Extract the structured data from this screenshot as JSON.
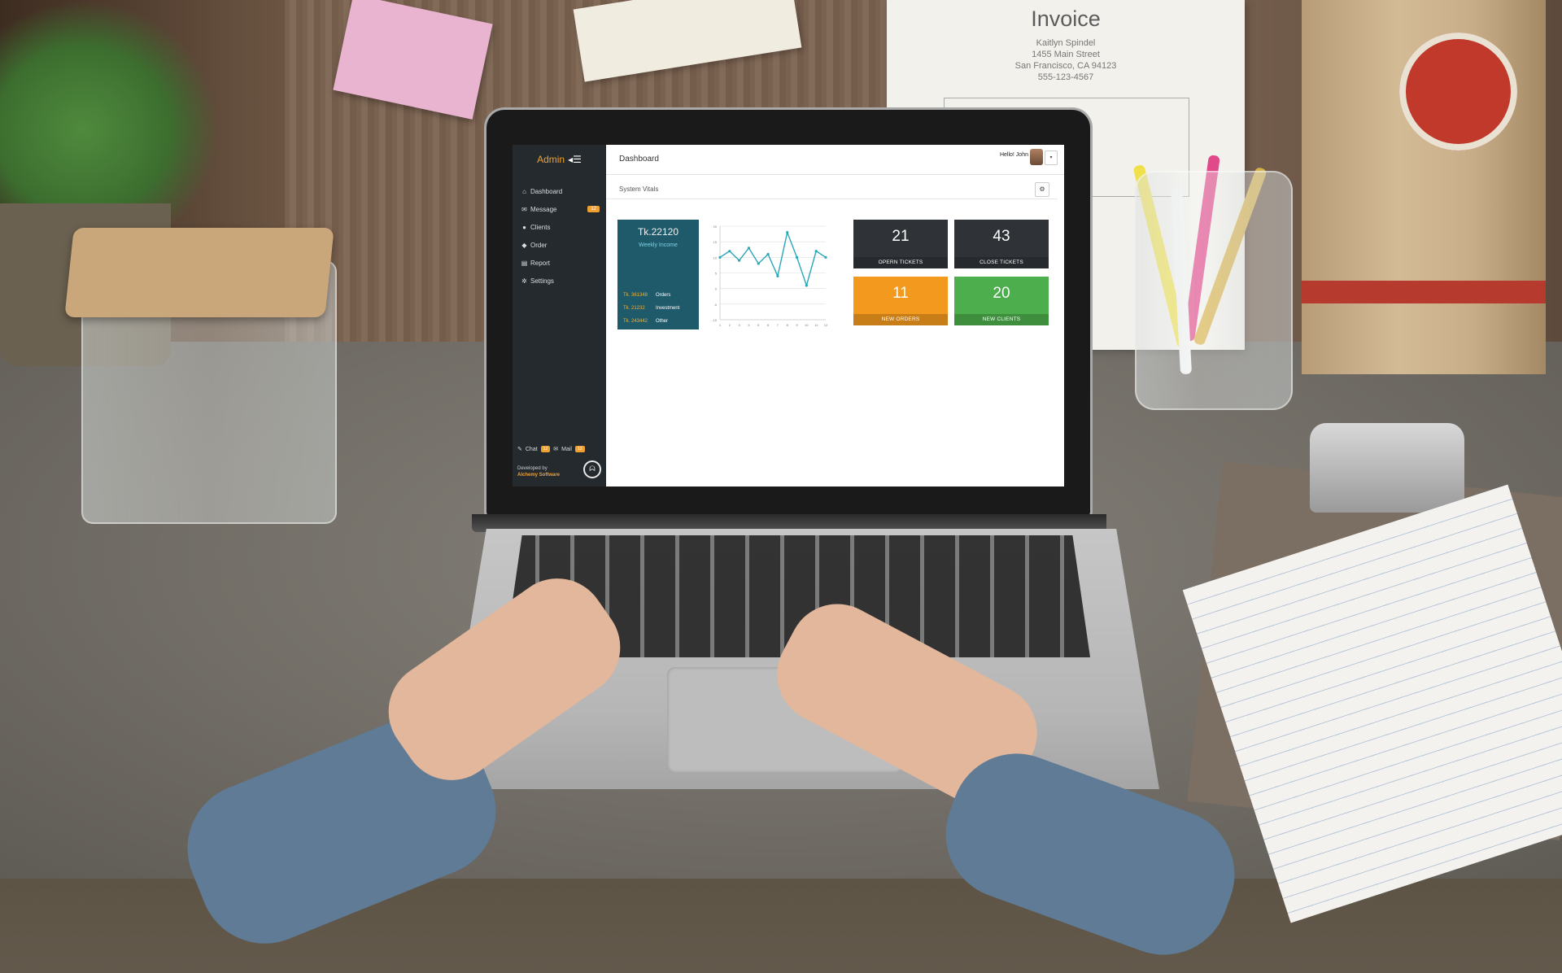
{
  "app": {
    "brand": "Admin",
    "page_title": "Dashboard",
    "greeting": "Hello! John"
  },
  "sidebar": {
    "items": [
      {
        "label": "Dashboard",
        "icon": "home-icon",
        "badge": ""
      },
      {
        "label": "Message",
        "icon": "envelope-icon",
        "badge": "12"
      },
      {
        "label": "Clients",
        "icon": "user-icon",
        "badge": ""
      },
      {
        "label": "Order",
        "icon": "tag-icon",
        "badge": ""
      },
      {
        "label": "Report",
        "icon": "report-icon",
        "badge": ""
      },
      {
        "label": "Settings",
        "icon": "gear-icon",
        "badge": ""
      }
    ],
    "footer": {
      "chat_label": "Chat",
      "chat_badge": "12",
      "mail_label": "Mail",
      "mail_badge": "12"
    },
    "developer": {
      "prefix": "Developed by",
      "company": "Alchemy Software"
    }
  },
  "panel": {
    "title": "System Vitals"
  },
  "income": {
    "amount": "Tk.22120",
    "caption": "Weekly Income",
    "rows": [
      {
        "value": "Tk. 361348",
        "label": "Orders"
      },
      {
        "value": "Tk. 21232",
        "label": "Investment"
      },
      {
        "value": "Tk. 243442",
        "label": "Other"
      }
    ]
  },
  "tiles": [
    {
      "value": "21",
      "label": "OPERN TICKETS",
      "color": "#2f3338"
    },
    {
      "value": "43",
      "label": "CLOSE TICKETS",
      "color": "#2f3338"
    },
    {
      "value": "11",
      "label": "NEW ORDERS",
      "color": "#f39a1e"
    },
    {
      "value": "20",
      "label": "NEW CLIENTS",
      "color": "#4cae4c"
    }
  ],
  "chart_data": {
    "type": "line",
    "x": [
      1,
      2,
      3,
      4,
      5,
      6,
      7,
      8,
      9,
      10,
      11,
      12
    ],
    "series": [
      {
        "values": [
          10,
          12,
          9,
          13,
          8,
          11,
          4,
          18,
          10,
          1,
          12,
          10
        ]
      }
    ],
    "ylim": [
      -10,
      20
    ],
    "grid": true,
    "color": "#2aa7b8"
  },
  "scene": {
    "invoice_title": "Invoice",
    "invoice_lines": [
      "Kaitlyn Spindel",
      "1455 Main Street",
      "San Francisco, CA 94123",
      "555-123-4567"
    ]
  }
}
